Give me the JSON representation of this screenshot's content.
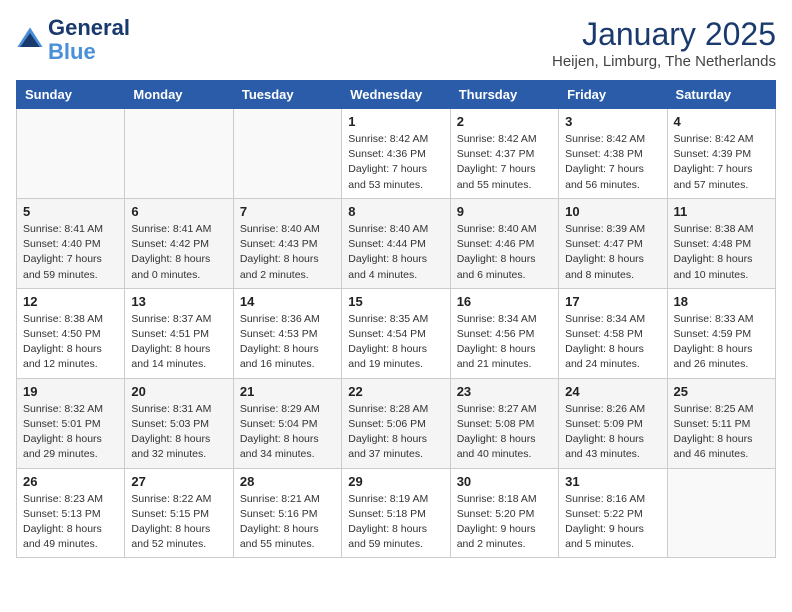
{
  "header": {
    "logo_line1": "General",
    "logo_line2": "Blue",
    "month": "January 2025",
    "location": "Heijen, Limburg, The Netherlands"
  },
  "weekdays": [
    "Sunday",
    "Monday",
    "Tuesday",
    "Wednesday",
    "Thursday",
    "Friday",
    "Saturday"
  ],
  "weeks": [
    [
      {
        "day": "",
        "info": ""
      },
      {
        "day": "",
        "info": ""
      },
      {
        "day": "",
        "info": ""
      },
      {
        "day": "1",
        "info": "Sunrise: 8:42 AM\nSunset: 4:36 PM\nDaylight: 7 hours and 53 minutes."
      },
      {
        "day": "2",
        "info": "Sunrise: 8:42 AM\nSunset: 4:37 PM\nDaylight: 7 hours and 55 minutes."
      },
      {
        "day": "3",
        "info": "Sunrise: 8:42 AM\nSunset: 4:38 PM\nDaylight: 7 hours and 56 minutes."
      },
      {
        "day": "4",
        "info": "Sunrise: 8:42 AM\nSunset: 4:39 PM\nDaylight: 7 hours and 57 minutes."
      }
    ],
    [
      {
        "day": "5",
        "info": "Sunrise: 8:41 AM\nSunset: 4:40 PM\nDaylight: 7 hours and 59 minutes."
      },
      {
        "day": "6",
        "info": "Sunrise: 8:41 AM\nSunset: 4:42 PM\nDaylight: 8 hours and 0 minutes."
      },
      {
        "day": "7",
        "info": "Sunrise: 8:40 AM\nSunset: 4:43 PM\nDaylight: 8 hours and 2 minutes."
      },
      {
        "day": "8",
        "info": "Sunrise: 8:40 AM\nSunset: 4:44 PM\nDaylight: 8 hours and 4 minutes."
      },
      {
        "day": "9",
        "info": "Sunrise: 8:40 AM\nSunset: 4:46 PM\nDaylight: 8 hours and 6 minutes."
      },
      {
        "day": "10",
        "info": "Sunrise: 8:39 AM\nSunset: 4:47 PM\nDaylight: 8 hours and 8 minutes."
      },
      {
        "day": "11",
        "info": "Sunrise: 8:38 AM\nSunset: 4:48 PM\nDaylight: 8 hours and 10 minutes."
      }
    ],
    [
      {
        "day": "12",
        "info": "Sunrise: 8:38 AM\nSunset: 4:50 PM\nDaylight: 8 hours and 12 minutes."
      },
      {
        "day": "13",
        "info": "Sunrise: 8:37 AM\nSunset: 4:51 PM\nDaylight: 8 hours and 14 minutes."
      },
      {
        "day": "14",
        "info": "Sunrise: 8:36 AM\nSunset: 4:53 PM\nDaylight: 8 hours and 16 minutes."
      },
      {
        "day": "15",
        "info": "Sunrise: 8:35 AM\nSunset: 4:54 PM\nDaylight: 8 hours and 19 minutes."
      },
      {
        "day": "16",
        "info": "Sunrise: 8:34 AM\nSunset: 4:56 PM\nDaylight: 8 hours and 21 minutes."
      },
      {
        "day": "17",
        "info": "Sunrise: 8:34 AM\nSunset: 4:58 PM\nDaylight: 8 hours and 24 minutes."
      },
      {
        "day": "18",
        "info": "Sunrise: 8:33 AM\nSunset: 4:59 PM\nDaylight: 8 hours and 26 minutes."
      }
    ],
    [
      {
        "day": "19",
        "info": "Sunrise: 8:32 AM\nSunset: 5:01 PM\nDaylight: 8 hours and 29 minutes."
      },
      {
        "day": "20",
        "info": "Sunrise: 8:31 AM\nSunset: 5:03 PM\nDaylight: 8 hours and 32 minutes."
      },
      {
        "day": "21",
        "info": "Sunrise: 8:29 AM\nSunset: 5:04 PM\nDaylight: 8 hours and 34 minutes."
      },
      {
        "day": "22",
        "info": "Sunrise: 8:28 AM\nSunset: 5:06 PM\nDaylight: 8 hours and 37 minutes."
      },
      {
        "day": "23",
        "info": "Sunrise: 8:27 AM\nSunset: 5:08 PM\nDaylight: 8 hours and 40 minutes."
      },
      {
        "day": "24",
        "info": "Sunrise: 8:26 AM\nSunset: 5:09 PM\nDaylight: 8 hours and 43 minutes."
      },
      {
        "day": "25",
        "info": "Sunrise: 8:25 AM\nSunset: 5:11 PM\nDaylight: 8 hours and 46 minutes."
      }
    ],
    [
      {
        "day": "26",
        "info": "Sunrise: 8:23 AM\nSunset: 5:13 PM\nDaylight: 8 hours and 49 minutes."
      },
      {
        "day": "27",
        "info": "Sunrise: 8:22 AM\nSunset: 5:15 PM\nDaylight: 8 hours and 52 minutes."
      },
      {
        "day": "28",
        "info": "Sunrise: 8:21 AM\nSunset: 5:16 PM\nDaylight: 8 hours and 55 minutes."
      },
      {
        "day": "29",
        "info": "Sunrise: 8:19 AM\nSunset: 5:18 PM\nDaylight: 8 hours and 59 minutes."
      },
      {
        "day": "30",
        "info": "Sunrise: 8:18 AM\nSunset: 5:20 PM\nDaylight: 9 hours and 2 minutes."
      },
      {
        "day": "31",
        "info": "Sunrise: 8:16 AM\nSunset: 5:22 PM\nDaylight: 9 hours and 5 minutes."
      },
      {
        "day": "",
        "info": ""
      }
    ]
  ]
}
